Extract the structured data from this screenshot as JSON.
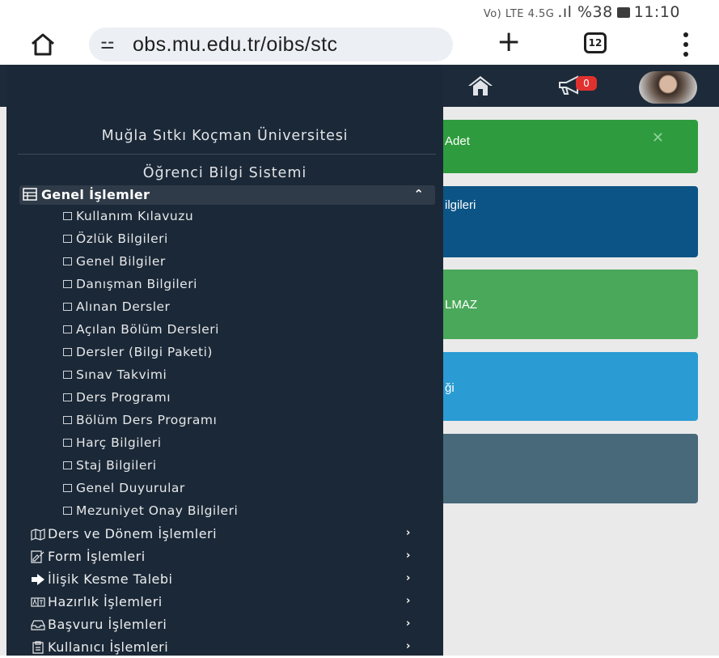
{
  "status_bar": {
    "signal_text": "Vo) LTE 4.5G",
    "battery": "%38",
    "time": "11:10"
  },
  "browser": {
    "url": "obs.mu.edu.tr/oibs/stc",
    "tab_count": "12"
  },
  "topbar": {
    "notification_count": "0"
  },
  "cards": [
    {
      "text": "Adet",
      "color": "#2e9c3e"
    },
    {
      "text": "ilgileri",
      "color": "#0c5486"
    },
    {
      "text": "LMAZ",
      "color": "#4aa85a"
    },
    {
      "text": "ği",
      "color": "#2a9bd3"
    },
    {
      "text": "",
      "color": "#47697a"
    }
  ],
  "sidebar": {
    "university": "Muğla Sıtkı Koçman Üniversitesi",
    "system": "Öğrenci Bilgi Sistemi",
    "active_group": "Genel İşlemler",
    "sub_items": [
      "Kullanım Kılavuzu",
      "Özlük Bilgileri",
      "Genel Bilgiler",
      "Danışman Bilgileri",
      "Alınan Dersler",
      "Açılan Bölüm Dersleri",
      "Dersler (Bilgi Paketi)",
      "Sınav Takvimi",
      "Ders Programı",
      "Bölüm Ders Programı",
      "Harç Bilgileri",
      "Staj Bilgileri",
      "Genel Duyurular",
      "Mezuniyet Onay Bilgileri"
    ],
    "groups": [
      {
        "label": "Ders ve Dönem İşlemleri",
        "icon": "map-icon"
      },
      {
        "label": "Form İşlemleri",
        "icon": "form-icon"
      },
      {
        "label": "İlişik Kesme Talebi",
        "icon": "exit-arrow-icon"
      },
      {
        "label": "Hazırlık İşlemleri",
        "icon": "language-icon"
      },
      {
        "label": "Başvuru İşlemleri",
        "icon": "inbox-icon"
      },
      {
        "label": "Kullanıcı İşlemleri",
        "icon": "clipboard-icon"
      }
    ]
  }
}
